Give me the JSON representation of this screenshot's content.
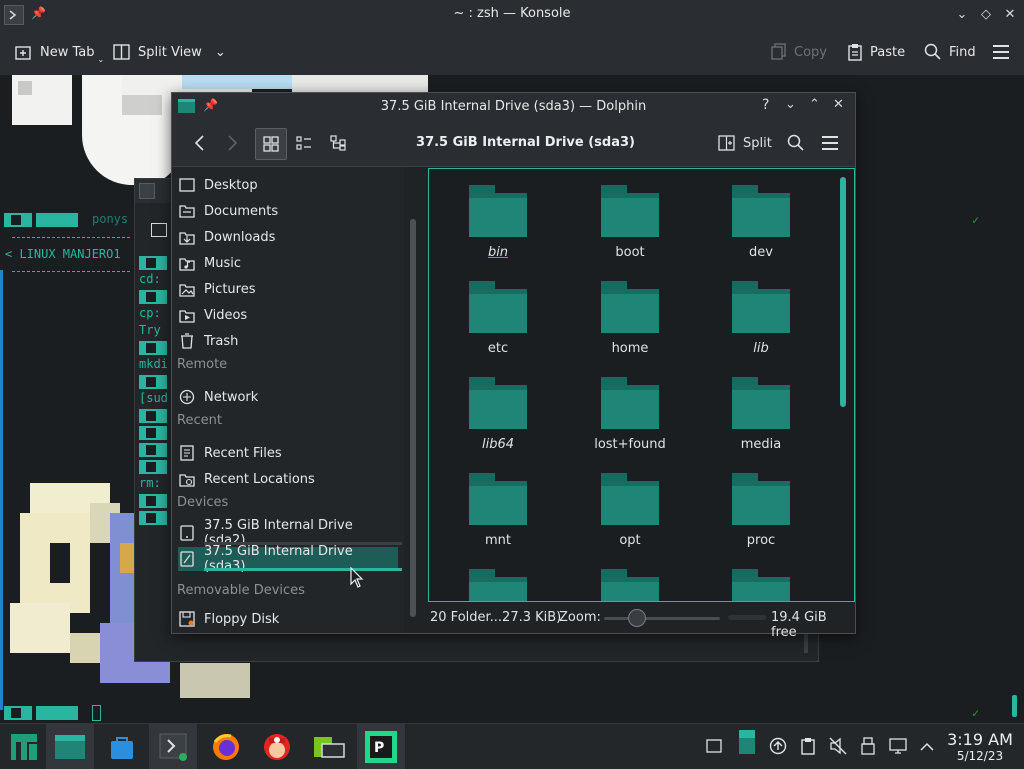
{
  "konsole": {
    "title": "~ : zsh — Konsole",
    "toolbar": {
      "new_tab": "New Tab",
      "split_view": "Split View",
      "copy": "Copy",
      "paste": "Paste",
      "find": "Find"
    },
    "terminal_lines": {
      "ponysay": "ponys",
      "banner": "< LINUX MANJERO1",
      "cd": "cd:",
      "cp": "cp:",
      "try": "Try",
      "mkdir": "mkdi",
      "sudo": "[sud",
      "rm": "rm:"
    }
  },
  "dolphin": {
    "title": "37.5 GiB Internal Drive (sda3) — Dolphin",
    "location": "37.5 GiB Internal Drive (sda3)",
    "split_label": "Split",
    "places": {
      "items": [
        {
          "label": "Desktop",
          "icon": "desktop-icon"
        },
        {
          "label": "Documents",
          "icon": "documents-icon"
        },
        {
          "label": "Downloads",
          "icon": "downloads-icon"
        },
        {
          "label": "Music",
          "icon": "music-icon"
        },
        {
          "label": "Pictures",
          "icon": "pictures-icon"
        },
        {
          "label": "Videos",
          "icon": "videos-icon"
        },
        {
          "label": "Trash",
          "icon": "trash-icon"
        }
      ],
      "remote_header": "Remote",
      "remote": [
        {
          "label": "Network",
          "icon": "network-icon"
        }
      ],
      "recent_header": "Recent",
      "recent": [
        {
          "label": "Recent Files",
          "icon": "recent-files-icon"
        },
        {
          "label": "Recent Locations",
          "icon": "recent-locations-icon"
        }
      ],
      "devices_header": "Devices",
      "devices": [
        {
          "label": "37.5 GiB Internal Drive (sda2)",
          "icon": "drive-icon"
        },
        {
          "label": "37.5 GiB Internal Drive (sda3)",
          "icon": "drive-icon"
        }
      ],
      "removable_header": "Removable Devices",
      "removable": [
        {
          "label": "Floppy Disk",
          "icon": "floppy-icon"
        }
      ]
    },
    "folders": [
      {
        "name": "bin",
        "link": true
      },
      {
        "name": "boot",
        "link": false
      },
      {
        "name": "dev",
        "link": false
      },
      {
        "name": "etc",
        "link": false
      },
      {
        "name": "home",
        "link": false
      },
      {
        "name": "lib",
        "link": true
      },
      {
        "name": "lib64",
        "link": true
      },
      {
        "name": "lost+found",
        "link": false
      },
      {
        "name": "media",
        "link": false
      },
      {
        "name": "mnt",
        "link": false
      },
      {
        "name": "opt",
        "link": false
      },
      {
        "name": "proc",
        "link": false
      }
    ],
    "status": {
      "summary": "20 Folder...27.3 KiB)",
      "zoom_label": "Zoom:",
      "free": "19.4 GiB free"
    }
  },
  "taskbar": {
    "time": "3:19 AM",
    "date": "5/12/23"
  },
  "colors": {
    "accent": "#2ab5a0",
    "folder": "#1e8577",
    "selection": "#1e5d57"
  }
}
